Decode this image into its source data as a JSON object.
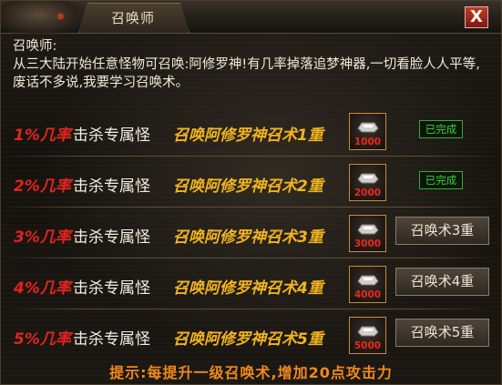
{
  "window": {
    "title": "召唤师",
    "close_label": "X"
  },
  "intro": {
    "npc_name": "召唤师:",
    "text": "从三大陆开始任意怪物可召唤:阿修罗神!有几率掉落追梦神器,一切看脸人人平等,废话不多说,我要学习召唤术。"
  },
  "quests": [
    {
      "rate": "1%几率",
      "task": "击杀专属怪",
      "skill": "召唤阿修罗神召术1重",
      "cost": "1000",
      "status": "已完成",
      "completed": true
    },
    {
      "rate": "2%几率",
      "task": "击杀专属怪",
      "skill": "召唤阿修罗神召术2重",
      "cost": "2000",
      "status": "已完成",
      "completed": true
    },
    {
      "rate": "3%几率",
      "task": "击杀专属怪",
      "skill": "召唤阿修罗神召术3重",
      "cost": "3000",
      "status": "召唤术3重",
      "completed": false
    },
    {
      "rate": "4%几率",
      "task": "击杀专属怪",
      "skill": "召唤阿修罗神召术4重",
      "cost": "4000",
      "status": "召唤术4重",
      "completed": false
    },
    {
      "rate": "5%几率",
      "task": "击杀专属怪",
      "skill": "召唤阿修罗神召术5重",
      "cost": "5000",
      "status": "召唤术5重",
      "completed": false
    }
  ],
  "hint": "提示:每提升一级召唤术,增加20点攻击力",
  "colors": {
    "rate": "#e0241e",
    "skill": "#f2b41e",
    "done": "#34d634",
    "hint": "#f08a1a",
    "cost": "#e8281e"
  },
  "icons": {
    "close": "close-icon",
    "cost_item": "silver-ingot-icon"
  }
}
